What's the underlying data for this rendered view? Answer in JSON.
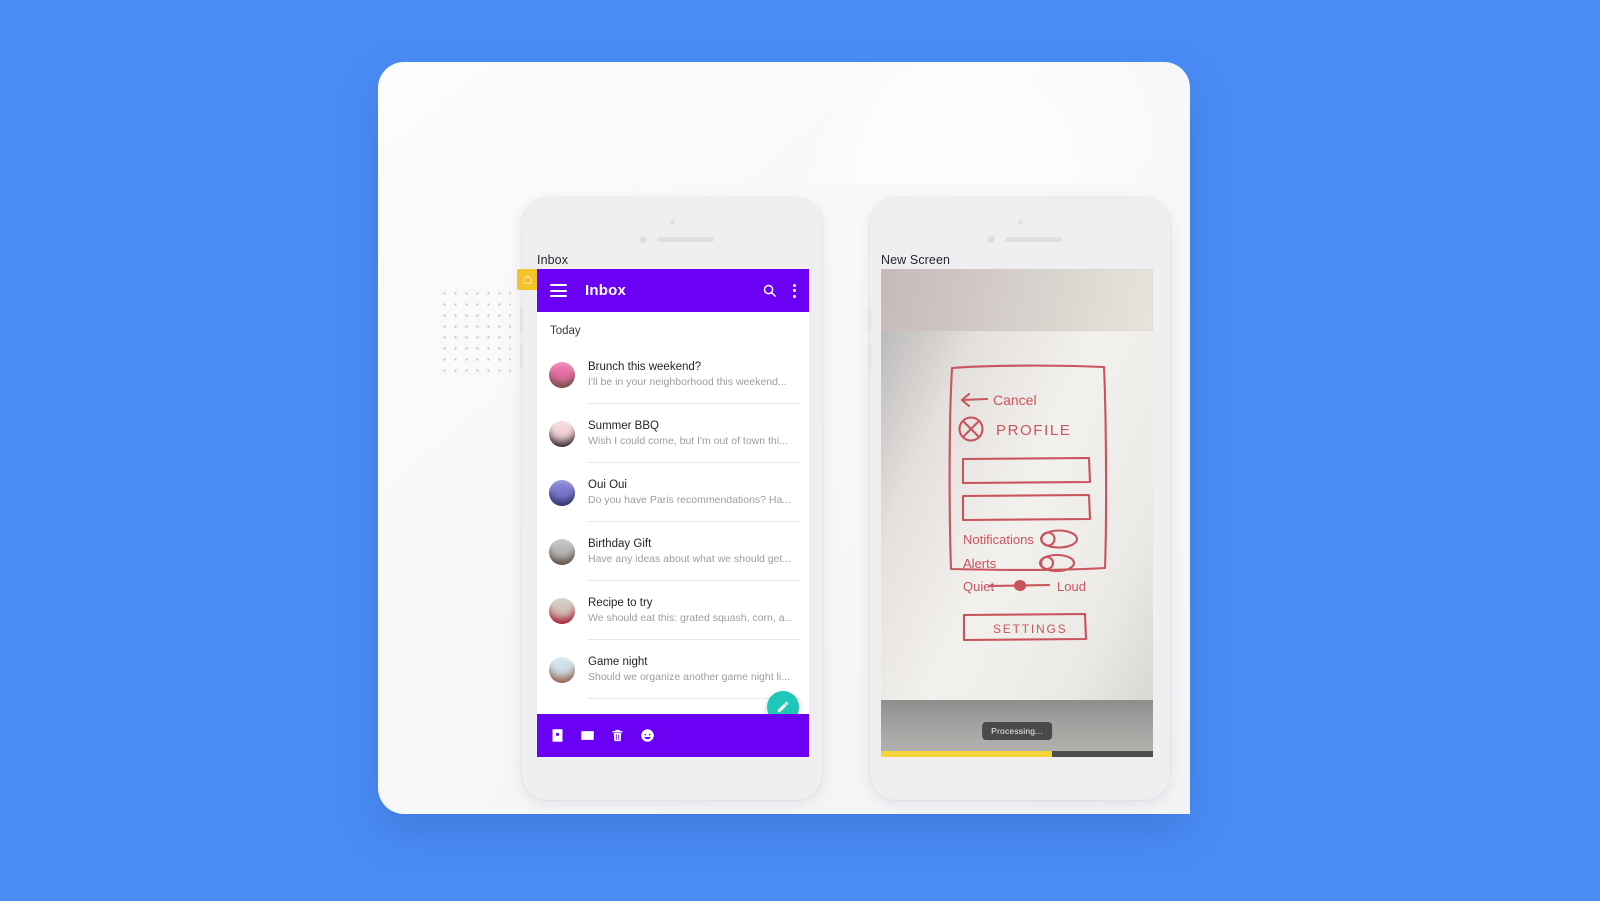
{
  "theme": {
    "background_blue": "#4a8cf6",
    "primary_purple": "#6a00f4",
    "accent_teal": "#1fc7b6",
    "badge_yellow": "#f5c22b",
    "progress_yellow": "#f5d33d"
  },
  "left_phone": {
    "screen_label": "Inbox",
    "appbar": {
      "title": "Inbox",
      "menu_icon": "hamburger-icon",
      "search_icon": "search-icon",
      "overflow_icon": "kebab-menu-icon"
    },
    "section_header": "Today",
    "messages": [
      {
        "subject": "Brunch this weekend?",
        "snippet": "I'll be in your neighborhood this weekend...",
        "avatar_bg": "#e86fa8",
        "avatar_fg": "#6d4b3a"
      },
      {
        "subject": "Summer BBQ",
        "snippet": "Wish I could come, but I'm out of town thi...",
        "avatar_bg": "#f3d5d9",
        "avatar_fg": "#2a2228"
      },
      {
        "subject": "Oui Oui",
        "snippet": "Do you have Paris recommendations? Ha...",
        "avatar_bg": "#7b7ad0",
        "avatar_fg": "#2f3160"
      },
      {
        "subject": "Birthday Gift",
        "snippet": "Have any ideas about what we should get...",
        "avatar_bg": "#b9b9bb",
        "avatar_fg": "#5d4a3c"
      },
      {
        "subject": "Recipe to try",
        "snippet": "We should eat this: grated squash, corn, a...",
        "avatar_bg": "#cfc6bd",
        "avatar_fg": "#a8182c"
      },
      {
        "subject": "Game night",
        "snippet": "Should we organize another game night li...",
        "avatar_bg": "#cfe1ea",
        "avatar_fg": "#8d5a3d"
      }
    ],
    "bottom_bar_icons": [
      "contact-card-icon",
      "envelope-icon",
      "trash-icon",
      "smiley-icon"
    ],
    "fab_icon": "pen-edit-icon"
  },
  "right_phone": {
    "screen_label": "New Screen",
    "sketch": {
      "back_label": "Cancel",
      "title": "PROFILE",
      "close_icon": "x-circle-icon",
      "rows": [
        {
          "label": "Notifications",
          "control": "toggle-switch"
        },
        {
          "label": "Alerts",
          "control": "toggle-switch"
        }
      ],
      "slider": {
        "left_label": "Quiet",
        "right_label": "Loud"
      },
      "button_label": "SETTINGS"
    },
    "toast": "Processing...",
    "progress_percent": 63
  },
  "canvas": {
    "home_badge_icon": "home-icon",
    "dot_grid": "dot-grid-pattern"
  }
}
